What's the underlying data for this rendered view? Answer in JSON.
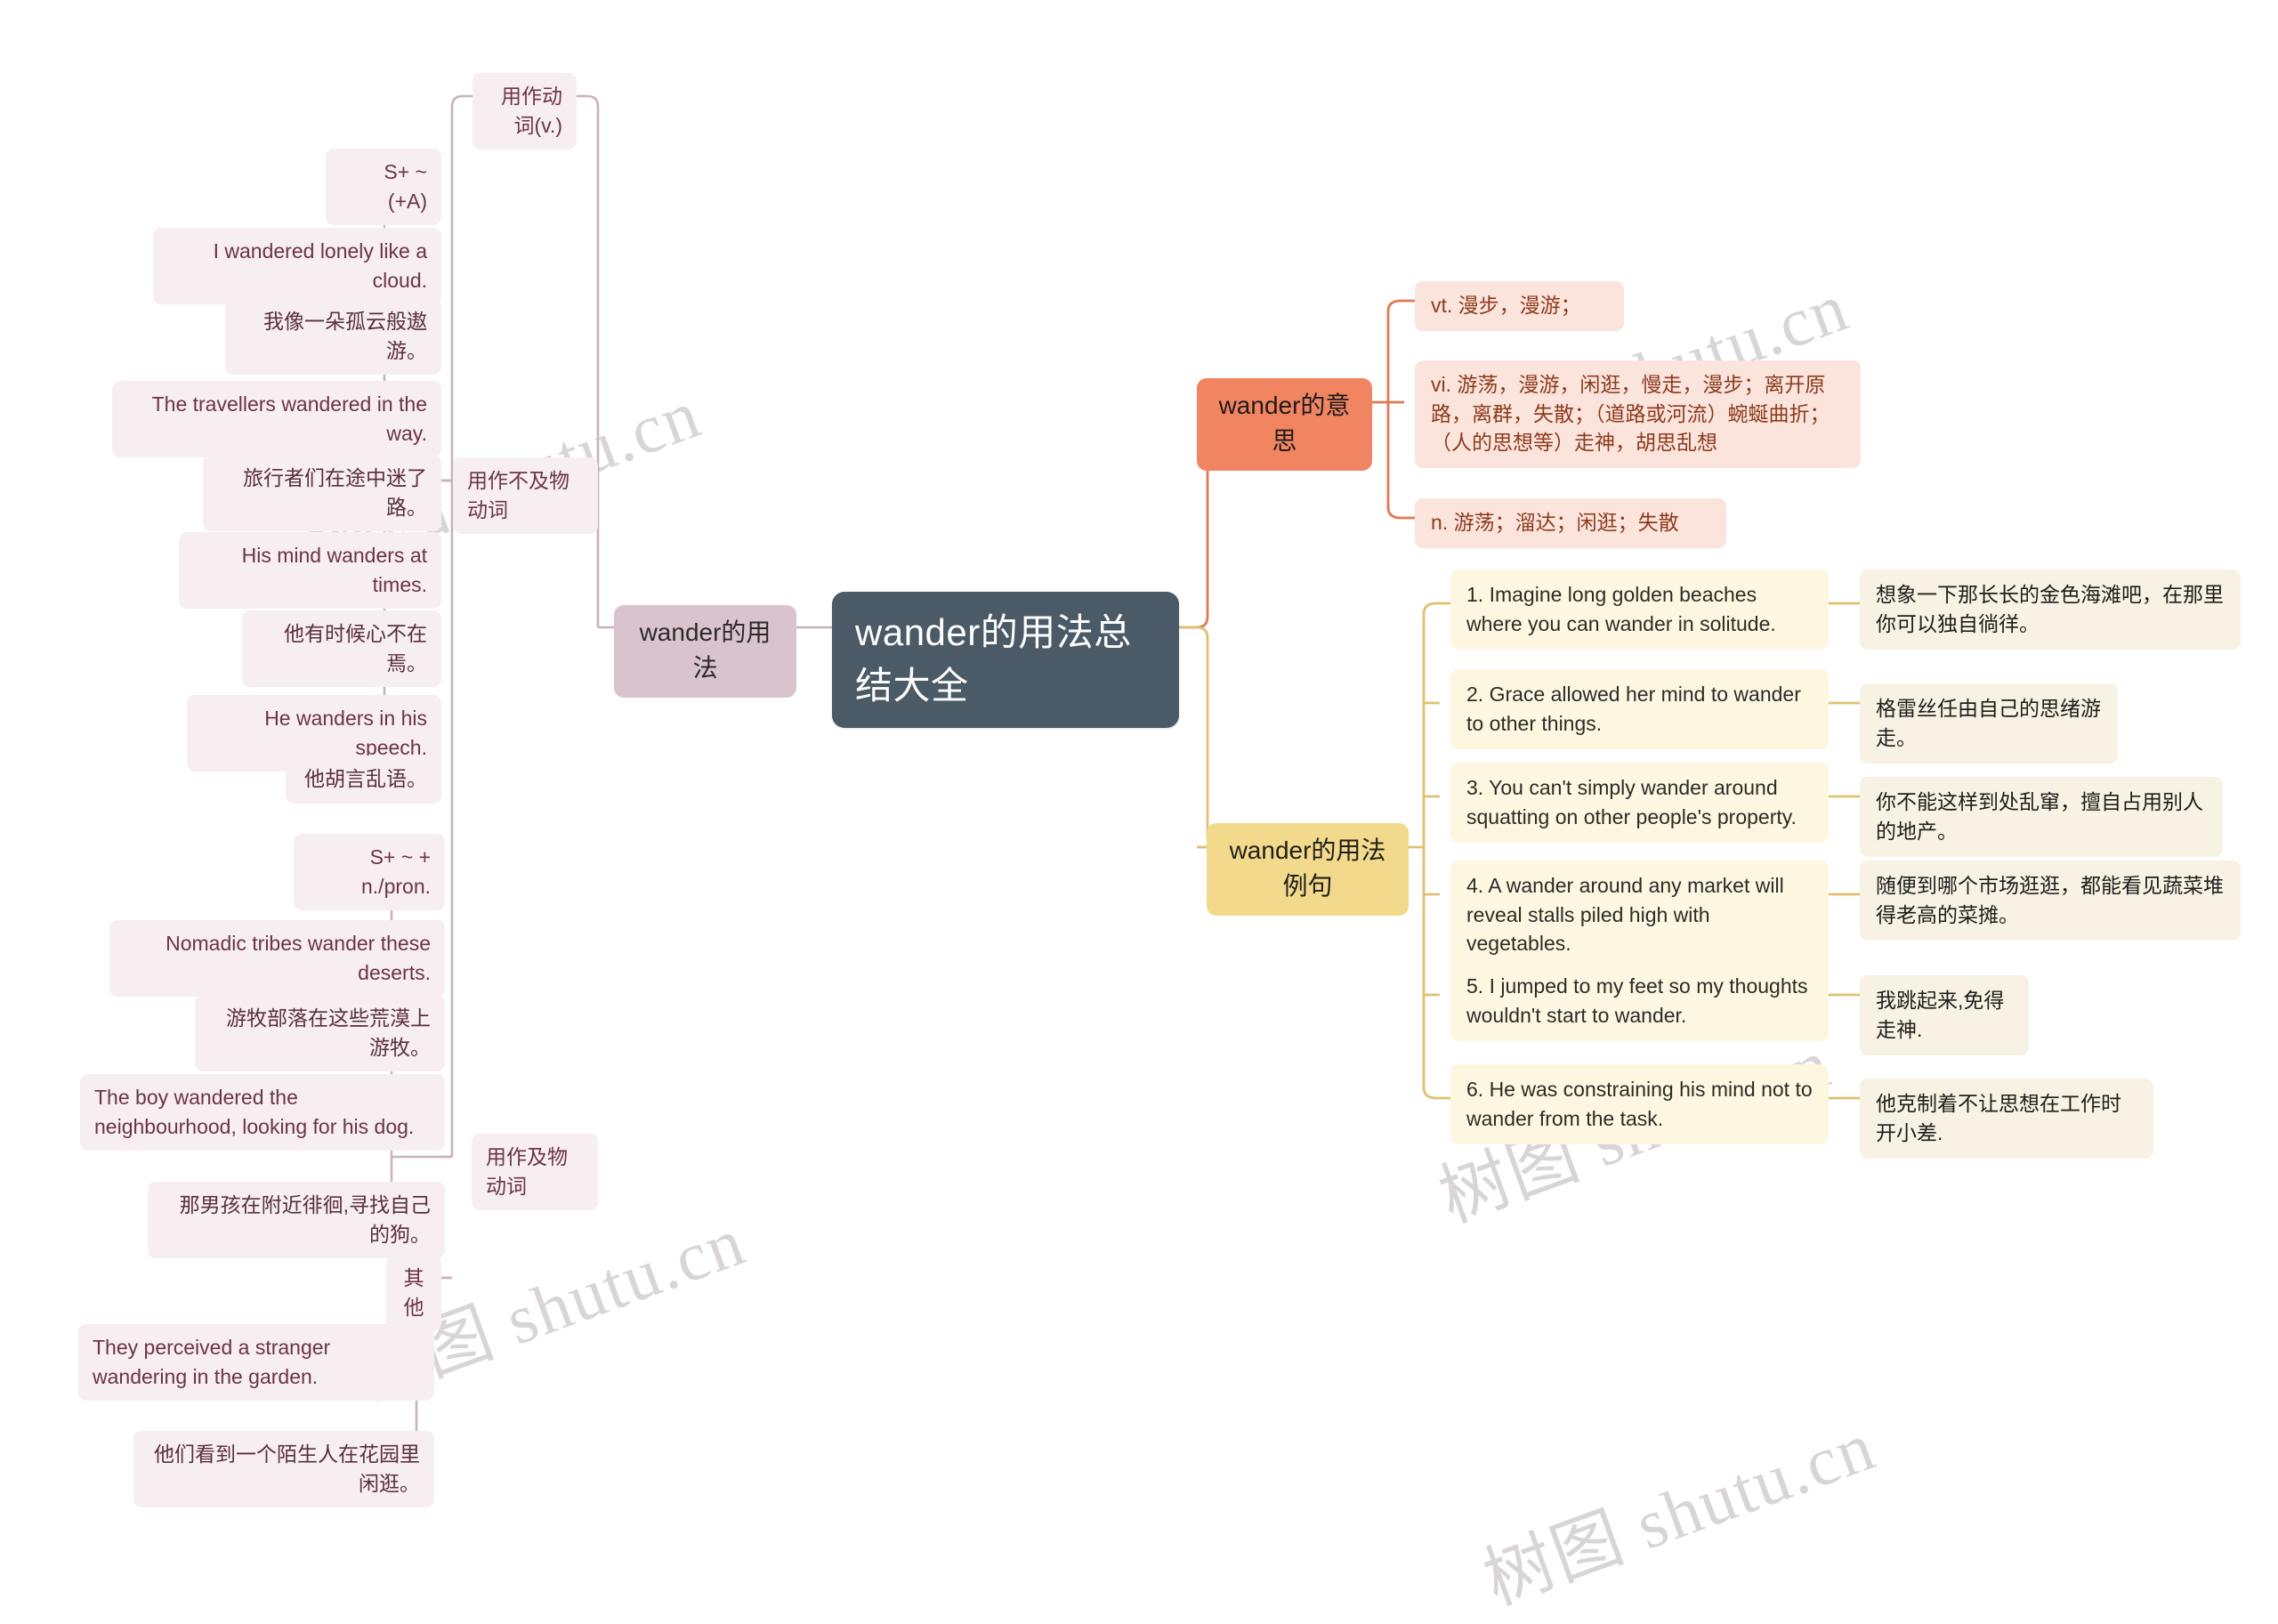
{
  "palette": {
    "root_bg": "#4b5a67",
    "root_fg": "#ffffff",
    "usage_bg": "#d9c3cc",
    "pink_bg": "#f6eef0",
    "pink_fg": "#6d3347",
    "meaning_bg": "#f18562",
    "orange_bg": "#fbe4dc",
    "orange_fg": "#8d3b1d",
    "example_bg": "#f3d98b",
    "yellow_bg": "#fdf7e2",
    "yellow2_bg": "#f7f2e3",
    "link_pink": "#c9b2ba",
    "link_orange": "#e07a52",
    "link_yellow": "#dfc170",
    "watermark": "#d9d5d6"
  },
  "watermark": {
    "text": "树图 shutu.cn"
  },
  "root": {
    "title": "wander的用法总结大全"
  },
  "branches": {
    "usage": {
      "label": "wander的用法",
      "groups": [
        {
          "label": "用作动词(v.)",
          "subgroups": [
            {
              "label": "用作不及物动词",
              "patterns": [
                {
                  "label": "S+ ~ (+A)",
                  "examples": [
                    {
                      "en": "I wandered lonely like a cloud.",
                      "cn": "我像一朵孤云般遨游。"
                    },
                    {
                      "en": "The travellers wandered in the way.",
                      "cn": "旅行者们在途中迷了路。"
                    },
                    {
                      "en": "His mind wanders at times.",
                      "cn": "他有时候心不在焉。"
                    },
                    {
                      "en": "He wanders in his speech.",
                      "cn": "他胡言乱语。"
                    }
                  ]
                }
              ]
            },
            {
              "label": "用作及物动词",
              "patterns": [
                {
                  "label": "S+ ~ + n./pron.",
                  "examples": [
                    {
                      "en": "Nomadic tribes wander these deserts.",
                      "cn": "游牧部落在这些荒漠上游牧。"
                    },
                    {
                      "en": "The boy wandered the neighbourhood, looking for his dog.",
                      "cn": "那男孩在附近徘徊,寻找自己的狗。"
                    }
                  ]
                }
              ]
            },
            {
              "label": "其他",
              "patterns": [
                {
                  "label": "",
                  "examples": [
                    {
                      "en": "They perceived a stranger wandering in the garden.",
                      "cn": "他们看到一个陌生人在花园里闲逛。"
                    }
                  ]
                }
              ]
            }
          ]
        }
      ]
    },
    "meaning": {
      "label": "wander的意思",
      "items": [
        {
          "text": "vt. 漫步，漫游；"
        },
        {
          "text": "vi. 游荡，漫游，闲逛，慢走，漫步；离开原路，离群，失散；（道路或河流）蜿蜒曲折；（人的思想等）走神，胡思乱想"
        },
        {
          "text": "n. 游荡；溜达；闲逛；失散"
        }
      ]
    },
    "examples": {
      "label": "wander的用法例句",
      "items": [
        {
          "en": "1. Imagine long golden beaches where you can wander in solitude.",
          "cn": "想象一下那长长的金色海滩吧，在那里你可以独自徜徉。"
        },
        {
          "en": "2. Grace allowed her mind to wander to other things.",
          "cn": "格雷丝任由自己的思绪游走。"
        },
        {
          "en": "3. You can't simply wander around squatting on other people's property.",
          "cn": "你不能这样到处乱窜，擅自占用别人的地产。"
        },
        {
          "en": "4. A wander around any market will reveal stalls piled high with vegetables.",
          "cn": "随便到哪个市场逛逛，都能看见蔬菜堆得老高的菜摊。"
        },
        {
          "en": "5. I jumped to my feet so my thoughts wouldn't start to wander.",
          "cn": "我跳起来,免得走神."
        },
        {
          "en": "6. He was constraining his mind not to wander from the task.",
          "cn": "他克制着不让思想在工作时开小差."
        }
      ]
    }
  }
}
